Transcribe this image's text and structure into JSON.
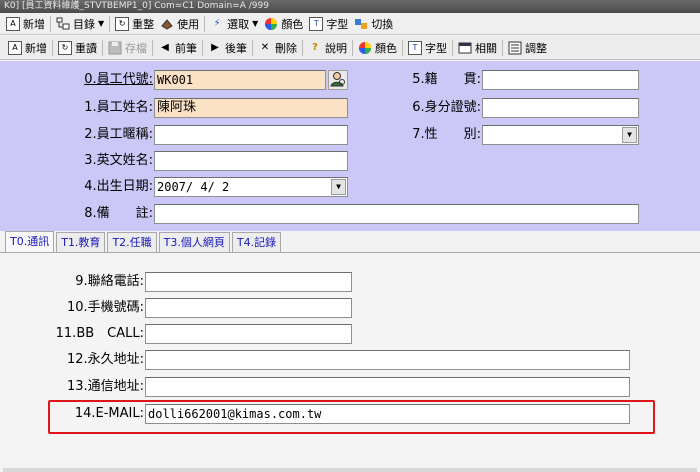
{
  "window": {
    "title": "K0] [員工資料維護_STVTBEMP1_0] Com=C1 Domain=A /999"
  },
  "toolbar_top": {
    "items": [
      {
        "label": "新增",
        "icon": "new-doc-icon"
      },
      {
        "label": "目錄",
        "icon": "directory-icon"
      },
      {
        "label": "重整",
        "icon": "refresh-icon"
      },
      {
        "label": "使用",
        "icon": "use-icon"
      },
      {
        "label": "選取",
        "icon": "select-icon"
      },
      {
        "label": "顏色",
        "icon": "color-wheel-icon"
      },
      {
        "label": "字型",
        "icon": "font-icon"
      },
      {
        "label": "切換",
        "icon": "switch-icon"
      }
    ]
  },
  "toolbar_main": {
    "items": [
      {
        "label": "新增",
        "icon": "new-doc-icon"
      },
      {
        "label": "重讀",
        "icon": "reload-icon"
      },
      {
        "label": "存檔",
        "icon": "save-disk-icon"
      },
      {
        "label": "前筆",
        "icon": "prev-record-icon"
      },
      {
        "label": "後筆",
        "icon": "next-record-icon"
      },
      {
        "label": "刪除",
        "icon": "delete-x-icon"
      },
      {
        "label": "說明",
        "icon": "help-icon"
      },
      {
        "label": "顏色",
        "icon": "color-wheel-icon"
      },
      {
        "label": "字型",
        "icon": "font-icon"
      },
      {
        "label": "相關",
        "icon": "related-icon"
      },
      {
        "label": "調整",
        "icon": "adjust-icon"
      }
    ]
  },
  "form": {
    "emp_code_label": "0.員工代號:",
    "emp_code_value": "WK001",
    "emp_name_label": "1.員工姓名:",
    "emp_name_value": "陳阿珠",
    "nickname_label": "2.員工暱稱:",
    "nickname_value": "",
    "english_name_label": "3.英文姓名:",
    "english_name_value": "",
    "birthday_label": "4.出生日期:",
    "birthday_value": "2007/ 4/ 2",
    "remark_label": "8.備　　註:",
    "remark_value": "",
    "origin_label": "5.籍　　貫:",
    "origin_value": "",
    "id_label": "6.身分證號:",
    "id_value": "",
    "gender_label": "7.性　　別:",
    "gender_value": ""
  },
  "tabs": [
    {
      "label": "T0.通訊",
      "active": true
    },
    {
      "label": "T1.教育",
      "active": false
    },
    {
      "label": "T2.任職",
      "active": false
    },
    {
      "label": "T3.個人網頁",
      "active": false
    },
    {
      "label": "T4.記錄",
      "active": false
    }
  ],
  "contact": {
    "phone_label": "9.聯絡電話:",
    "phone_value": "",
    "mobile_label": "10.手機號碼:",
    "mobile_value": "",
    "bbcall_label": "11.BB　CALL:",
    "bbcall_value": "",
    "perm_addr_label": "12.永久地址:",
    "perm_addr_value": "",
    "mail_addr_label": "13.通信地址:",
    "mail_addr_value": "",
    "email_label": "14.E-MAIL:",
    "email_value": "dolli662001@kimas.com.tw"
  },
  "colors": {
    "form_bg": "#cbc7f7",
    "key_field_bg": "#fbe1c6",
    "highlight_border": "#e0141b",
    "tab_text": "#1818b8"
  }
}
